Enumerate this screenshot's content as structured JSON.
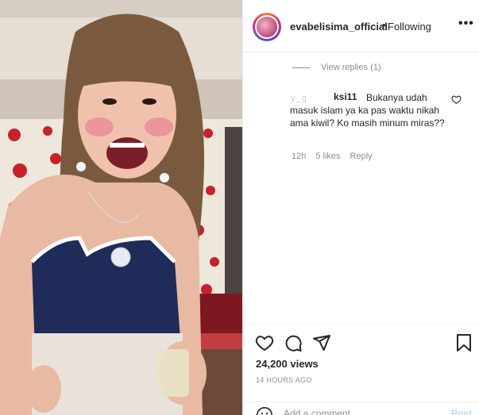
{
  "header": {
    "username": "evabelisima_official",
    "dot": "•",
    "following_label": "Following",
    "more_label": "•••"
  },
  "comments": {
    "view_replies_label": "View replies (1)",
    "comment": {
      "user_blurred": "y_g",
      "username": "ksi11",
      "text": "Bukanya udah masuk islam ya ka pas waktu nikah ama kiwil? Ko masih minum miras??",
      "time": "12h",
      "likes": "5 likes",
      "reply_label": "Reply"
    }
  },
  "actions": {
    "like_icon": "heart-icon",
    "comment_icon": "comment-icon",
    "share_icon": "send-icon",
    "save_icon": "bookmark-icon",
    "views": "24,200 views",
    "time_ago": "14 HOURS AGO"
  },
  "add_comment": {
    "placeholder": "Add a comment...",
    "post_label": "Post"
  },
  "colors": {
    "accent_post": "#b3dbff",
    "muted": "#8e8e8e",
    "text": "#262626"
  }
}
